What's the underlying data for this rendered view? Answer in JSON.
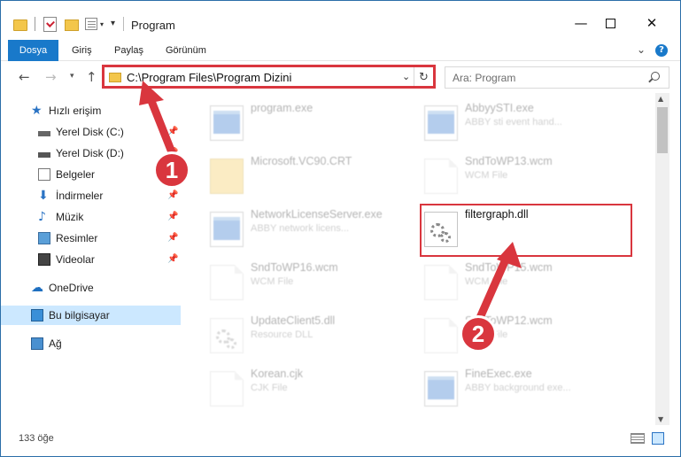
{
  "window": {
    "title": "Program",
    "controls": {
      "minimize": "—",
      "maximize": "",
      "close": "✕"
    }
  },
  "ribbon": {
    "tabs": [
      {
        "label": "Dosya",
        "active": true
      },
      {
        "label": "Giriş"
      },
      {
        "label": "Paylaş"
      },
      {
        "label": "Görünüm"
      }
    ],
    "help": "?"
  },
  "navbar": {
    "address": "C:\\Program Files\\Program Dizini",
    "search_placeholder": "Ara: Program"
  },
  "sidebar": {
    "items": [
      {
        "label": "Hızlı erişim",
        "icon": "star-icon"
      },
      {
        "label": "Yerel Disk (C:)",
        "icon": "drive-icon",
        "pinned": true
      },
      {
        "label": "Yerel Disk (D:)",
        "icon": "drive-icon",
        "pinned": true
      },
      {
        "label": "Belgeler",
        "icon": "documents-icon",
        "pinned": true
      },
      {
        "label": "İndirmeler",
        "icon": "downloads-icon",
        "pinned": true
      },
      {
        "label": "Müzik",
        "icon": "music-icon",
        "pinned": true
      },
      {
        "label": "Resimler",
        "icon": "pictures-icon",
        "pinned": true
      },
      {
        "label": "Videolar",
        "icon": "videos-icon",
        "pinned": true
      },
      {
        "label": "OneDrive",
        "icon": "cloud-icon"
      },
      {
        "label": "Bu bilgisayar",
        "icon": "computer-icon",
        "selected": true
      },
      {
        "label": "Ağ",
        "icon": "network-icon"
      }
    ]
  },
  "files": [
    {
      "name": "program.exe",
      "desc": "",
      "icon": "exe-icon",
      "faded": true
    },
    {
      "name": "AbbyySTI.exe",
      "desc": "ABBY sti event hand...",
      "icon": "exe-icon",
      "faded": true
    },
    {
      "name": "Microsoft.VC90.CRT",
      "desc": "",
      "icon": "folder-icon",
      "faded": true
    },
    {
      "name": "SndToWP13.wcm",
      "desc": "WCM File",
      "icon": "document-icon",
      "faded": true
    },
    {
      "name": "NetworkLicenseServer.exe",
      "desc": "ABBY network licens...",
      "icon": "exe-icon",
      "faded": true
    },
    {
      "name": "filtergraph.dll",
      "desc": "",
      "icon": "dll-gear-icon",
      "faded": false
    },
    {
      "name": "SndToWP16.wcm",
      "desc": "WCM File",
      "icon": "document-icon",
      "faded": true
    },
    {
      "name": "SndToWP15.wcm",
      "desc": "WCM File",
      "icon": "document-icon",
      "faded": true
    },
    {
      "name": "UpdateClient5.dll",
      "desc": "Resource DLL",
      "icon": "dll-gear-icon",
      "faded": true
    },
    {
      "name": "SndToWP12.wcm",
      "desc": "WCM File",
      "icon": "document-icon",
      "faded": true
    },
    {
      "name": "Korean.cjk",
      "desc": "CJK File",
      "icon": "document-icon",
      "faded": true
    },
    {
      "name": "FineExec.exe",
      "desc": "ABBY background exe...",
      "icon": "exe-icon",
      "faded": true
    }
  ],
  "status": {
    "item_count": "133 öğe"
  },
  "annotations": {
    "step1": "1",
    "step2": "2",
    "color": "#d9363e"
  }
}
